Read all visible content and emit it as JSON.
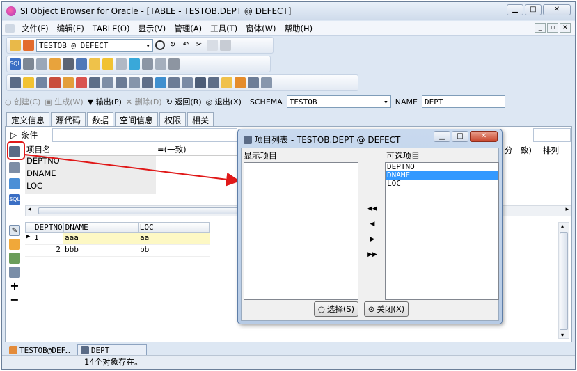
{
  "window": {
    "title": "SI Object Browser for Oracle - [TABLE - TESTOB.DEPT @ DEFECT]"
  },
  "menu": [
    "文件(F)",
    "编辑(E)",
    "TABLE(O)",
    "显示(V)",
    "管理(A)",
    "工具(T)",
    "窗体(W)",
    "帮助(H)"
  ],
  "toolbar": {
    "connection": "TESTOB @ DEFECT"
  },
  "actions": {
    "create": "创建(C)",
    "generate": "生成(W)",
    "output": "输出(P)",
    "delete": "删除(D)",
    "back": "返回(R)",
    "exit": "退出(X)",
    "schema_label": "SCHEMA",
    "schema_value": "TESTOB",
    "name_label": "NAME",
    "name_value": "DEPT"
  },
  "tabs": [
    "定义信息",
    "源代码",
    "数据",
    "空间信息",
    "权限",
    "相关"
  ],
  "condition": {
    "label": "条件"
  },
  "upper_grid": {
    "headers": [
      "项目名",
      "=(一致)"
    ],
    "rows": [
      "DEPTNO",
      "DNAME",
      "LOC"
    ],
    "right_headers": [
      "分一致)",
      "排列"
    ]
  },
  "data_grid": {
    "headers": [
      "DEPTNO",
      "DNAME",
      "LOC"
    ],
    "rows": [
      [
        "1",
        "aaa",
        "aa"
      ],
      [
        "2",
        "bbb",
        "bb"
      ]
    ]
  },
  "doc_tabs": [
    "TESTOB@DEF…",
    "DEPT"
  ],
  "status": "14个对象存在。",
  "dialog": {
    "title": "项目列表 - TESTOB.DEPT @ DEFECT",
    "left_label": "显示项目",
    "right_label": "可选项目",
    "items": [
      "DEPTNO",
      "DNAME",
      "LOC"
    ],
    "selected": "DNAME",
    "select_btn": "选择(S)",
    "close_btn": "关闭(X)"
  },
  "colors": {
    "accent": "#3399ff",
    "annotation": "#e01818",
    "highlight_row": "#fdf8c4"
  }
}
